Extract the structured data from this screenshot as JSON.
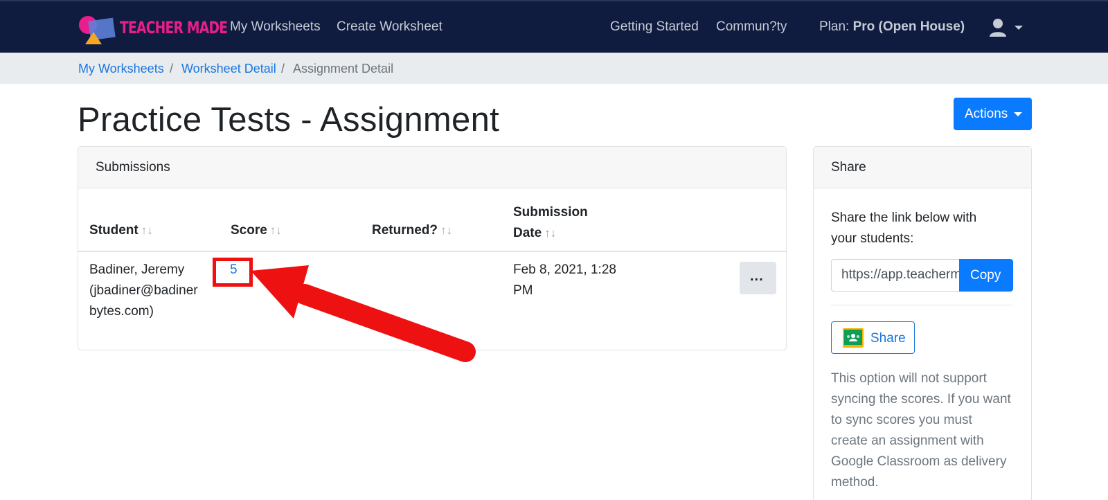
{
  "navbar": {
    "brand": "TEACHER MADE",
    "links": [
      "My Worksheets",
      "Create Worksheet",
      "Getting Started",
      "Commun?ty"
    ],
    "plan_label": "Plan:",
    "plan_value": "Pro (Open House)",
    "user_icon": "user-icon",
    "bg_color": "#0f1c3f"
  },
  "breadcrumb": {
    "items": [
      "My Worksheets",
      "Worksheet Detail",
      "Assignment Detail"
    ],
    "separator": "/"
  },
  "page": {
    "title": "Practice Tests - Assignment",
    "actions_label": "Actions"
  },
  "submissions": {
    "header": "Submissions",
    "columns": [
      {
        "label": "Student",
        "sort": "↑↓"
      },
      {
        "label": "Score",
        "sort": "↑↓"
      },
      {
        "label": "Returned?",
        "sort": "↑↓"
      },
      {
        "label_line1": "Submission",
        "label_line2": "Date",
        "sort": "↑↓"
      }
    ],
    "rows": [
      {
        "student_name": "Badiner, Jeremy",
        "student_email_1": "(jbadiner@badiner",
        "student_email_2": "bytes.com)",
        "score": "5",
        "returned": "",
        "date_line1": "Feb 8, 2021, 1:28",
        "date_line2": "PM",
        "more_label": "..."
      }
    ]
  },
  "share": {
    "header": "Share",
    "text": "Share the link below with your students:",
    "link_value": "https://app.teachermade.com",
    "copy_label": "Copy",
    "google_share_label": "Share",
    "google_icon": "google-classroom-icon",
    "note": "This option will not support syncing the scores. If you want to sync scores you must create an assignment with Google Classroom as delivery method."
  },
  "colors": {
    "primary": "#0a7bff",
    "link": "#1976e0",
    "annotation": "#ee1111",
    "brand_pink": "#e91e8c"
  }
}
